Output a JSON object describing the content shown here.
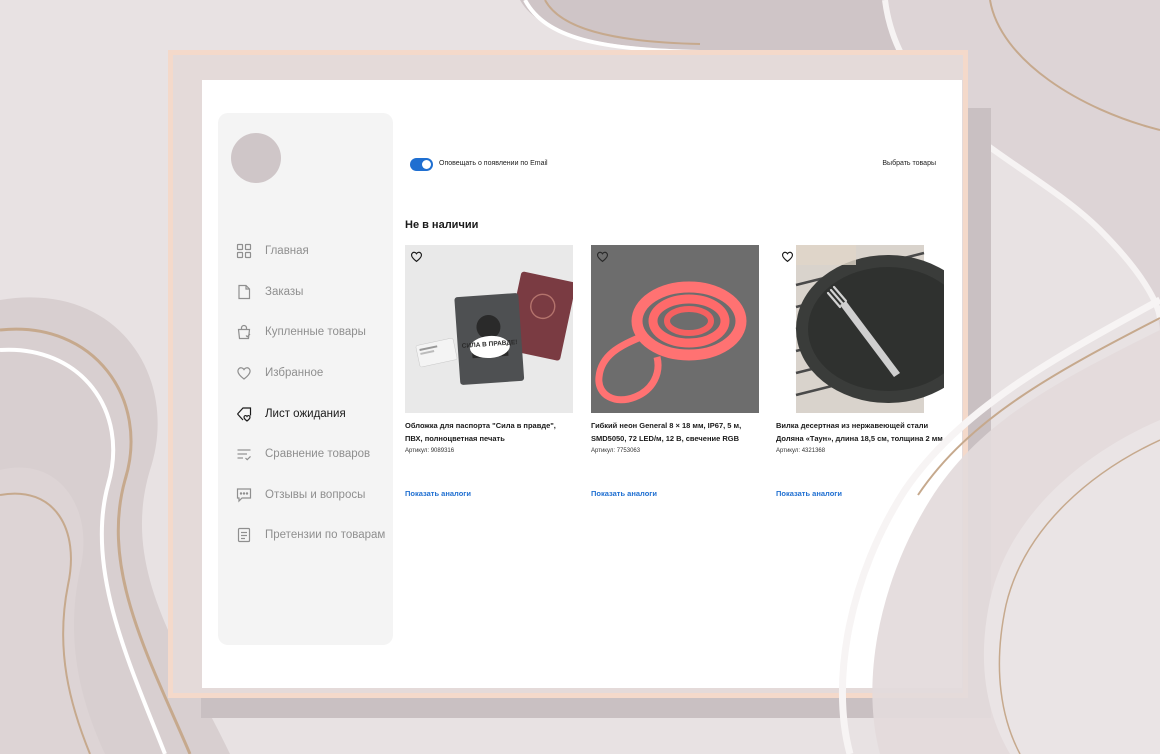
{
  "sidebar": {
    "items": [
      {
        "label": "Главная",
        "icon": "grid-icon",
        "active": false
      },
      {
        "label": "Заказы",
        "icon": "document-icon",
        "active": false
      },
      {
        "label": "Купленные товары",
        "icon": "shopping-bag-check-icon",
        "active": false
      },
      {
        "label": "Избранное",
        "icon": "heart-icon",
        "active": false
      },
      {
        "label": "Лист ожидания",
        "icon": "tag-heart-icon",
        "active": true
      },
      {
        "label": "Сравнение товаров",
        "icon": "compare-list-icon",
        "active": false
      },
      {
        "label": "Отзывы и вопросы",
        "icon": "chat-bubble-icon",
        "active": false
      },
      {
        "label": "Претензии по товарам",
        "icon": "claim-document-icon",
        "active": false
      }
    ]
  },
  "header": {
    "notify_label": "Оповещать о появлении по Email",
    "notify_enabled": true,
    "select_label": "Выбрать товары"
  },
  "section": {
    "title": "Не в наличии"
  },
  "products": [
    {
      "title": "Обложка для паспорта \"Сила в правде\", ПВХ, полноцветная печать",
      "sku_label": "Артикул:",
      "sku": "9089316",
      "analogs_label": "Показать аналоги",
      "image_text": "СИЛА В ПРАВДЕ!"
    },
    {
      "title": "Гибкий неон General 8 × 18 мм, IP67, 5 м, SMD5050, 72 LED/м, 12 В, свечение RGB",
      "sku_label": "Артикул:",
      "sku": "7753063",
      "analogs_label": "Показать аналоги"
    },
    {
      "title": "Вилка десертная из нержавеющей стали Доляна «Таун», длина 18,5 см, толщина 2 мм",
      "sku_label": "Артикул:",
      "sku": "4321368",
      "analogs_label": "Показать аналоги"
    }
  ],
  "colors": {
    "accent": "#1f6fd1",
    "sidebar_bg": "#f4f4f4",
    "active_text": "#1a1a1a",
    "inactive_text": "#8f8f8f"
  }
}
